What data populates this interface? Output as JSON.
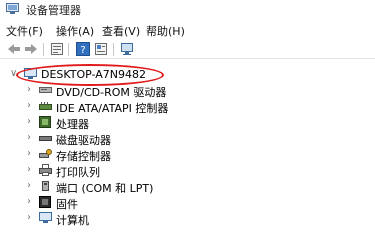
{
  "window": {
    "title": "设备管理器"
  },
  "menu": [
    {
      "label": "文件(F)"
    },
    {
      "label": "操作(A)"
    },
    {
      "label": "查看(V)"
    },
    {
      "label": "帮助(H)"
    }
  ],
  "tree": {
    "root": {
      "label": "DESKTOP-A7N9482"
    },
    "items": [
      {
        "label": "DVD/CD-ROM 驱动器",
        "icon": "dvd-drive-icon"
      },
      {
        "label": "IDE ATA/ATAPI 控制器",
        "icon": "ide-controller-icon"
      },
      {
        "label": "处理器",
        "icon": "processor-icon"
      },
      {
        "label": "磁盘驱动器",
        "icon": "disk-drive-icon"
      },
      {
        "label": "存储控制器",
        "icon": "storage-controller-icon"
      },
      {
        "label": "打印队列",
        "icon": "printer-icon"
      },
      {
        "label": "端口 (COM 和 LPT)",
        "icon": "port-icon"
      },
      {
        "label": "固件",
        "icon": "firmware-icon"
      },
      {
        "label": "计算机",
        "icon": "computer-icon"
      }
    ]
  },
  "annotation": {
    "color": "#e01a1a"
  }
}
